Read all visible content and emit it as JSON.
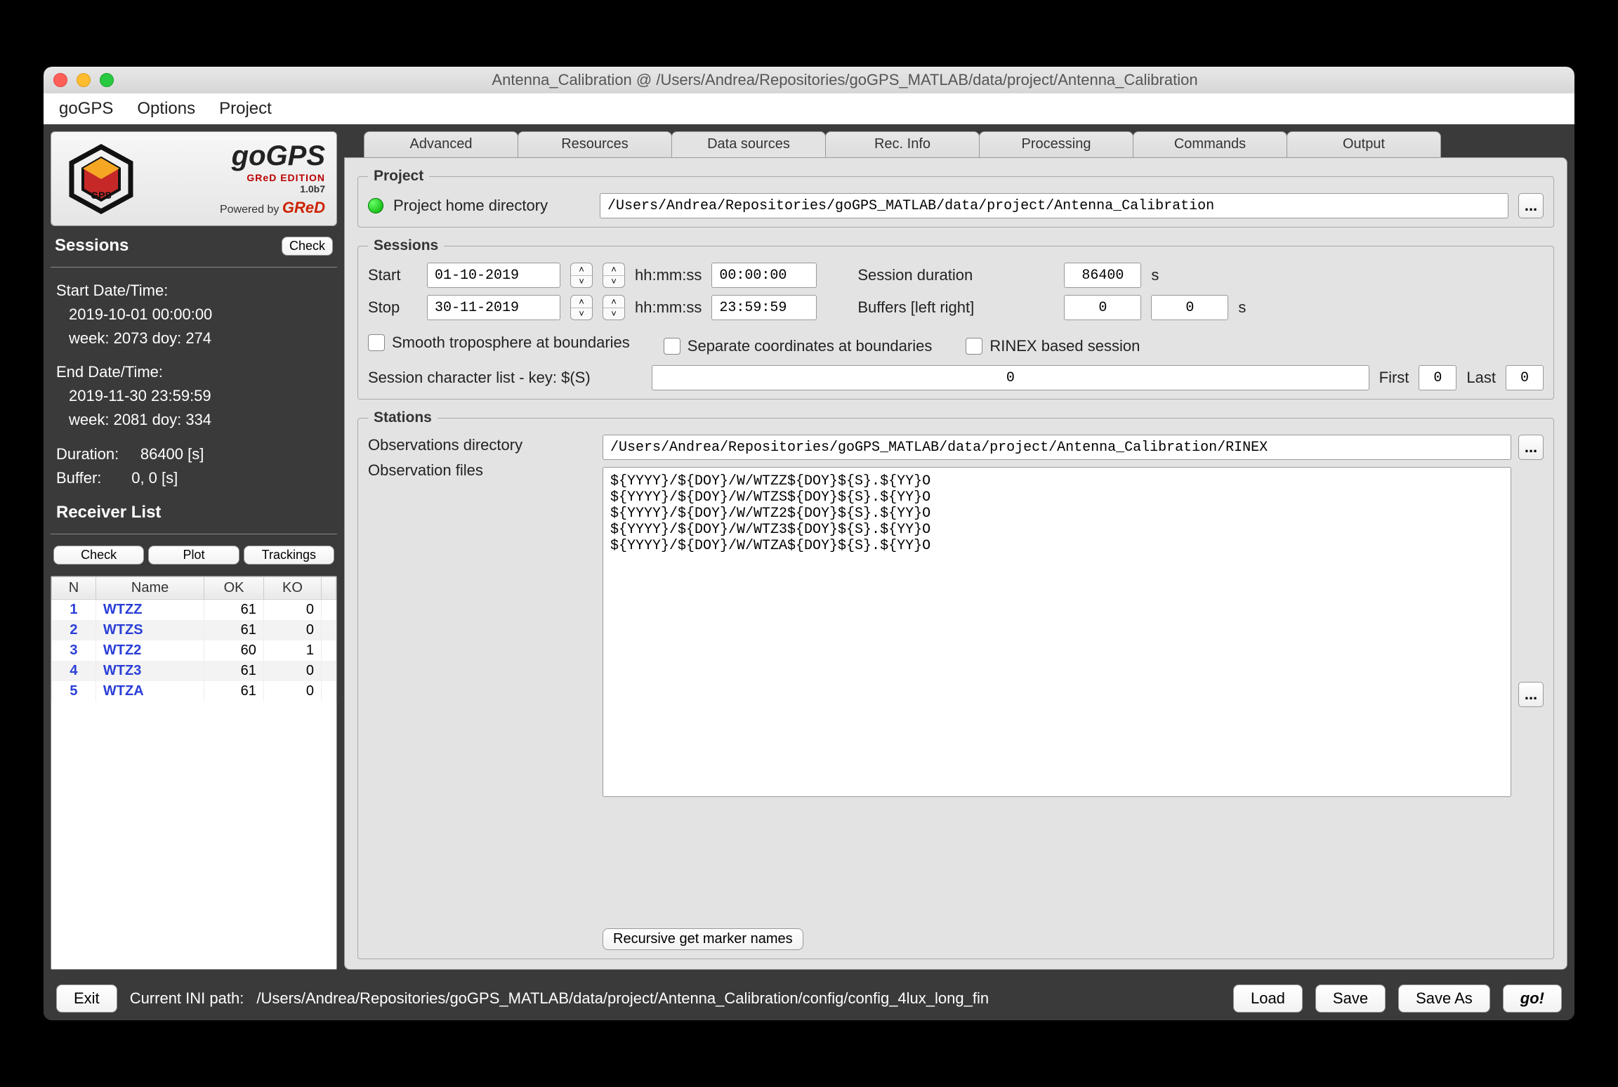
{
  "window": {
    "title": "Antenna_Calibration @ /Users/Andrea/Repositories/goGPS_MATLAB/data/project/Antenna_Calibration"
  },
  "menubar": [
    "goGPS",
    "Options",
    "Project"
  ],
  "logo": {
    "name": "goGPS",
    "edition": "GReD EDITION",
    "version": "1.0b7",
    "powered": "Powered by ",
    "powered_brand": "GReD"
  },
  "side": {
    "sessions_title": "Sessions",
    "check_btn": "Check",
    "start_label": "Start Date/Time:",
    "start_val": "2019-10-01   00:00:00",
    "start_week": "week: 2073 doy: 274",
    "end_label": "End Date/Time:",
    "end_val": "2019-11-30   23:59:59",
    "end_week": "week: 2081 doy: 334",
    "duration_label": "Duration:",
    "duration_val": "86400 [s]",
    "buffer_label": "Buffer:",
    "buffer_val": "0,      0 [s]",
    "rcv_title": "Receiver List",
    "rcv_btns": {
      "check": "Check",
      "plot": "Plot",
      "track": "Trackings"
    },
    "table": {
      "cols": [
        "N",
        "Name",
        "OK",
        "KO"
      ],
      "rows": [
        {
          "n": "1",
          "name": "WTZZ",
          "ok": "61",
          "ko": "0"
        },
        {
          "n": "2",
          "name": "WTZS",
          "ok": "61",
          "ko": "0"
        },
        {
          "n": "3",
          "name": "WTZ2",
          "ok": "60",
          "ko": "1"
        },
        {
          "n": "4",
          "name": "WTZ3",
          "ok": "61",
          "ko": "0"
        },
        {
          "n": "5",
          "name": "WTZA",
          "ok": "61",
          "ko": "0"
        }
      ]
    }
  },
  "tabs": [
    "Advanced",
    "Resources",
    "Data sources",
    "Rec. Info",
    "Processing",
    "Commands",
    "Output"
  ],
  "project": {
    "legend": "Project",
    "home_label": "Project home directory",
    "home_value": "/Users/Andrea/Repositories/goGPS_MATLAB/data/project/Antenna_Calibration"
  },
  "sessions": {
    "legend": "Sessions",
    "start": "Start",
    "stop": "Stop",
    "start_date": "01-10-2019",
    "stop_date": "30-11-2019",
    "hms": "hh:mm:ss",
    "start_time": "00:00:00",
    "stop_time": "23:59:59",
    "dur_label": "Session duration",
    "dur_val": "86400",
    "dur_unit": "s",
    "buf_label": "Buffers [left right]",
    "buf_l": "0",
    "buf_r": "0",
    "buf_unit": "s",
    "chk_smooth": "Smooth troposphere at boundaries",
    "chk_sep": "Separate coordinates at boundaries",
    "chk_rinex": "RINEX based session",
    "sclist_label": "Session character list - key: $(S)",
    "sclist_val": "0",
    "first": "First",
    "first_v": "0",
    "last": "Last",
    "last_v": "0"
  },
  "stations": {
    "legend": "Stations",
    "obsdir_label": "Observations directory",
    "obsdir_val": "/Users/Andrea/Repositories/goGPS_MATLAB/data/project/Antenna_Calibration/RINEX",
    "obsfiles_label": "Observation files",
    "obsfiles_text": "${YYYY}/${DOY}/W/WTZZ${DOY}${S}.${YY}O\n${YYYY}/${DOY}/W/WTZS${DOY}${S}.${YY}O\n${YYYY}/${DOY}/W/WTZ2${DOY}${S}.${YY}O\n${YYYY}/${DOY}/W/WTZ3${DOY}${S}.${YY}O\n${YYYY}/${DOY}/W/WTZA${DOY}${S}.${YY}O",
    "recursive_btn": "Recursive get marker names"
  },
  "footer": {
    "exit": "Exit",
    "ini_label": "Current INI path:",
    "ini_path": "/Users/Andrea/Repositories/goGPS_MATLAB/data/project/Antenna_Calibration/config/config_4lux_long_fin",
    "load": "Load",
    "save": "Save",
    "saveas": "Save As",
    "go": "go!"
  }
}
